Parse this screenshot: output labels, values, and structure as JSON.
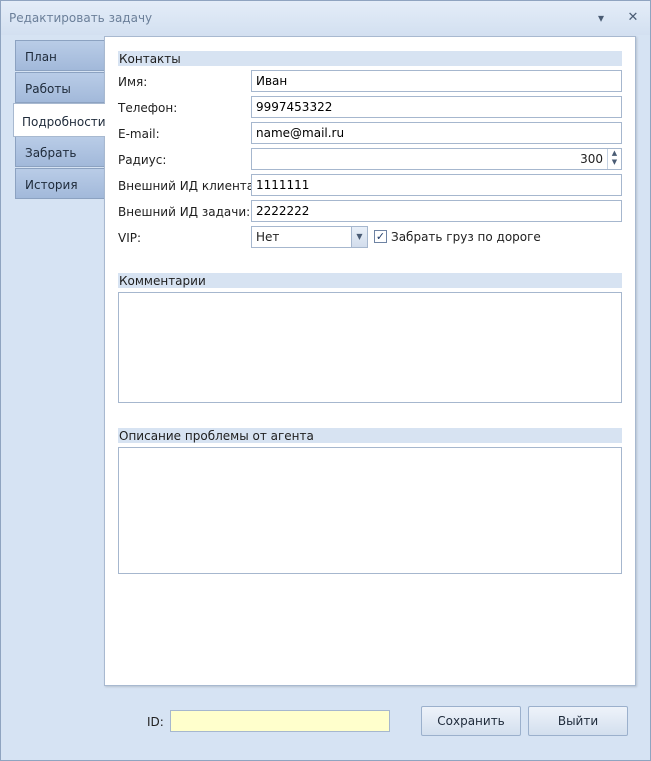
{
  "window": {
    "title": "Редактировать задачу",
    "pin_icon": "pin-icon",
    "close_icon": "close-icon"
  },
  "tabs": [
    {
      "label": "План",
      "active": false
    },
    {
      "label": "Работы",
      "active": false
    },
    {
      "label": "Подробности",
      "active": true
    },
    {
      "label": "Забрать",
      "active": false
    },
    {
      "label": "История",
      "active": false
    }
  ],
  "contacts": {
    "header": "Контакты",
    "name_label": "Имя:",
    "name_value": "Иван",
    "phone_label": "Телефон:",
    "phone_value": "9997453322",
    "email_label": "E-mail:",
    "email_value": "name@mail.ru",
    "radius_label": "Радиус:",
    "radius_value": "300",
    "client_id_label": "Внешний ИД клиента:",
    "client_id_value": "1111111",
    "task_id_label": "Внешний ИД задачи:",
    "task_id_value": "2222222",
    "vip_label": "VIP:",
    "vip_value": "Нет",
    "pickup_label": "Забрать груз по дороге",
    "pickup_checked": true
  },
  "comments": {
    "header": "Комментарии",
    "value": ""
  },
  "problem": {
    "header": "Описание проблемы от агента",
    "value": ""
  },
  "footer": {
    "id_label": "ID:",
    "id_value": "",
    "save_label": "Сохранить",
    "exit_label": "Выйти"
  },
  "colors": {
    "background": "#d6e3f3",
    "section_header": "#d7e3f2",
    "id_field": "#ffffcc"
  }
}
